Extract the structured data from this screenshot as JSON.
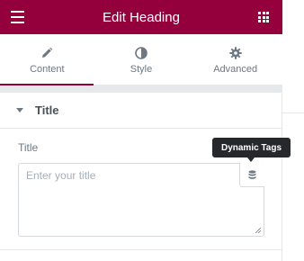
{
  "header": {
    "title": "Edit Heading",
    "menu_icon": "hamburger-icon",
    "apps_icon": "grid-icon",
    "background_color": "#93003c"
  },
  "tabs": [
    {
      "label": "Content",
      "icon": "pencil-icon",
      "active": true
    },
    {
      "label": "Style",
      "icon": "half-circle-icon",
      "active": false
    },
    {
      "label": "Advanced",
      "icon": "gear-icon",
      "active": false
    }
  ],
  "section": {
    "title": "Title",
    "expanded": true
  },
  "field": {
    "label": "Title",
    "placeholder": "Enter your title",
    "value": ""
  },
  "dynamic_tags": {
    "tooltip": "Dynamic Tags",
    "icon": "database-icon"
  },
  "colors": {
    "accent": "#93003c",
    "text": "#6d7882",
    "tooltip_bg": "#26292c"
  }
}
